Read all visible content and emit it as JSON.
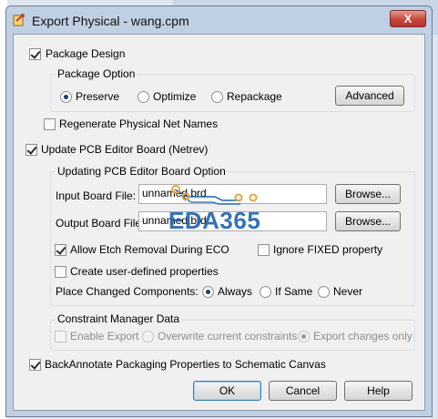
{
  "window": {
    "title": "Export Physical - wang.cpm",
    "close_glyph": "X"
  },
  "package_design": {
    "label": "Package Design",
    "checked": true,
    "package_option": {
      "title": "Package Option",
      "options": [
        "Preserve",
        "Optimize",
        "Repackage"
      ],
      "selected": "Preserve",
      "advanced_label": "Advanced"
    },
    "regenerate": {
      "label": "Regenerate Physical Net Names",
      "checked": false
    }
  },
  "update_pcb": {
    "label": "Update PCB Editor Board (Netrev)",
    "checked": true,
    "group_title": "Updating PCB Editor Board Option",
    "input_board": {
      "label": "Input Board File:",
      "value": "unnamed.brd",
      "browse_label": "Browse..."
    },
    "output_board": {
      "label": "Output Board File:",
      "value": "unnamed.brd",
      "browse_label": "Browse..."
    },
    "allow_etch": {
      "label": "Allow Etch Removal During ECO",
      "checked": true
    },
    "ignore_fixed": {
      "label": "Ignore FIXED property",
      "checked": false
    },
    "user_defined": {
      "label": "Create user-defined properties",
      "checked": false
    },
    "place_changed": {
      "label": "Place Changed Components:",
      "options": [
        "Always",
        "If Same",
        "Never"
      ],
      "selected": "Always"
    }
  },
  "constraint_manager": {
    "title": "Constraint Manager Data",
    "enable_export": {
      "label": "Enable Export",
      "checked": false
    },
    "options": [
      "Overwrite current constraints",
      "Export changes only"
    ],
    "selected": "Export changes only"
  },
  "backannotate": {
    "label": "BackAnnotate Packaging Properties to Schematic Canvas",
    "checked": true
  },
  "buttons": {
    "ok": "OK",
    "cancel": "Cancel",
    "help": "Help"
  },
  "watermark": {
    "text": "EDA365"
  },
  "colors": {
    "accent": "#1d63b0",
    "watermark_orange": "#e8a33a"
  }
}
